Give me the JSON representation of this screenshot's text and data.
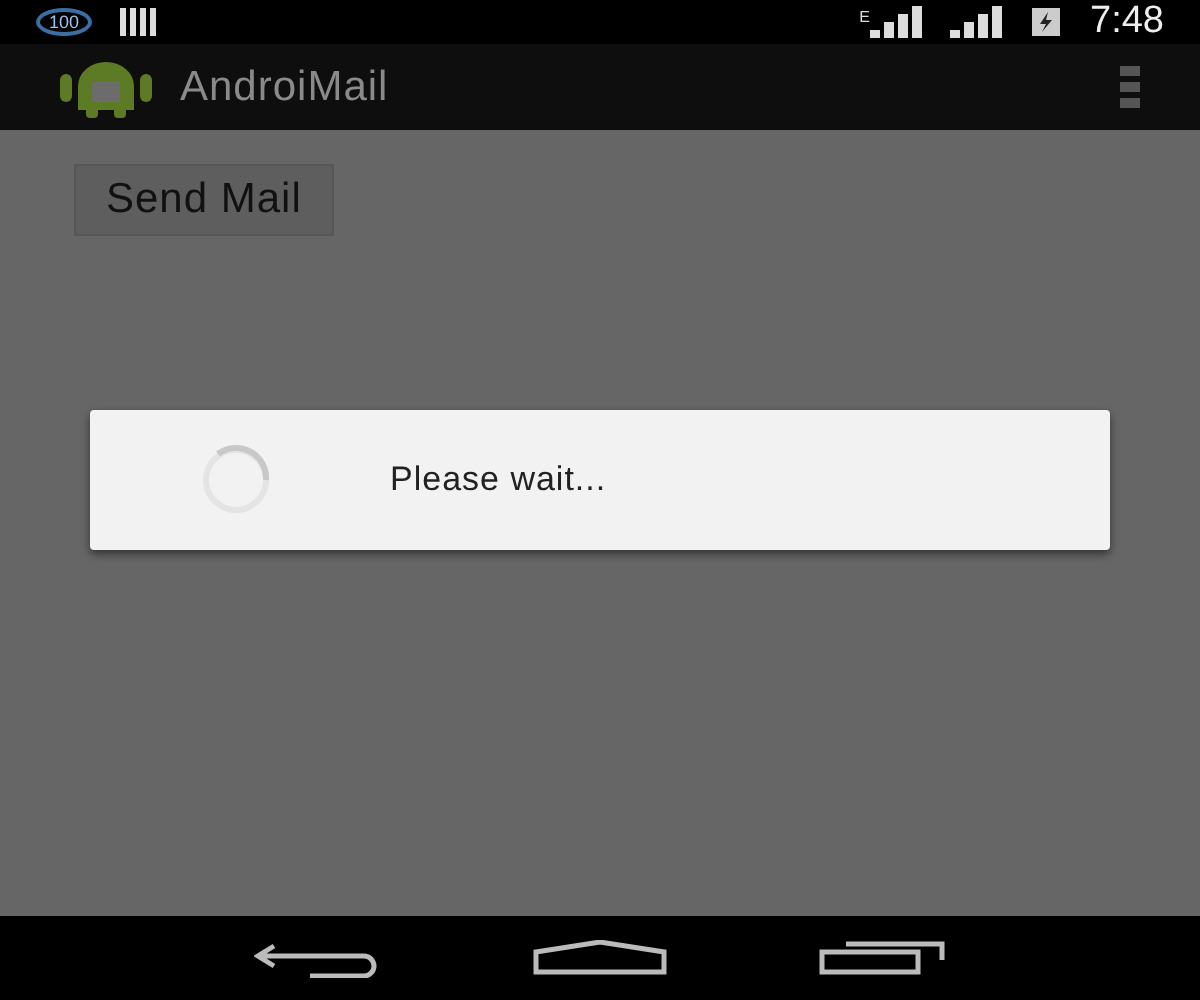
{
  "status_bar": {
    "battery_badge": "100",
    "network_type": "E",
    "time": "7:48"
  },
  "action_bar": {
    "title": "AndroiMail"
  },
  "content": {
    "button": "Send Mail"
  },
  "dialog": {
    "message": "Please wait..."
  }
}
